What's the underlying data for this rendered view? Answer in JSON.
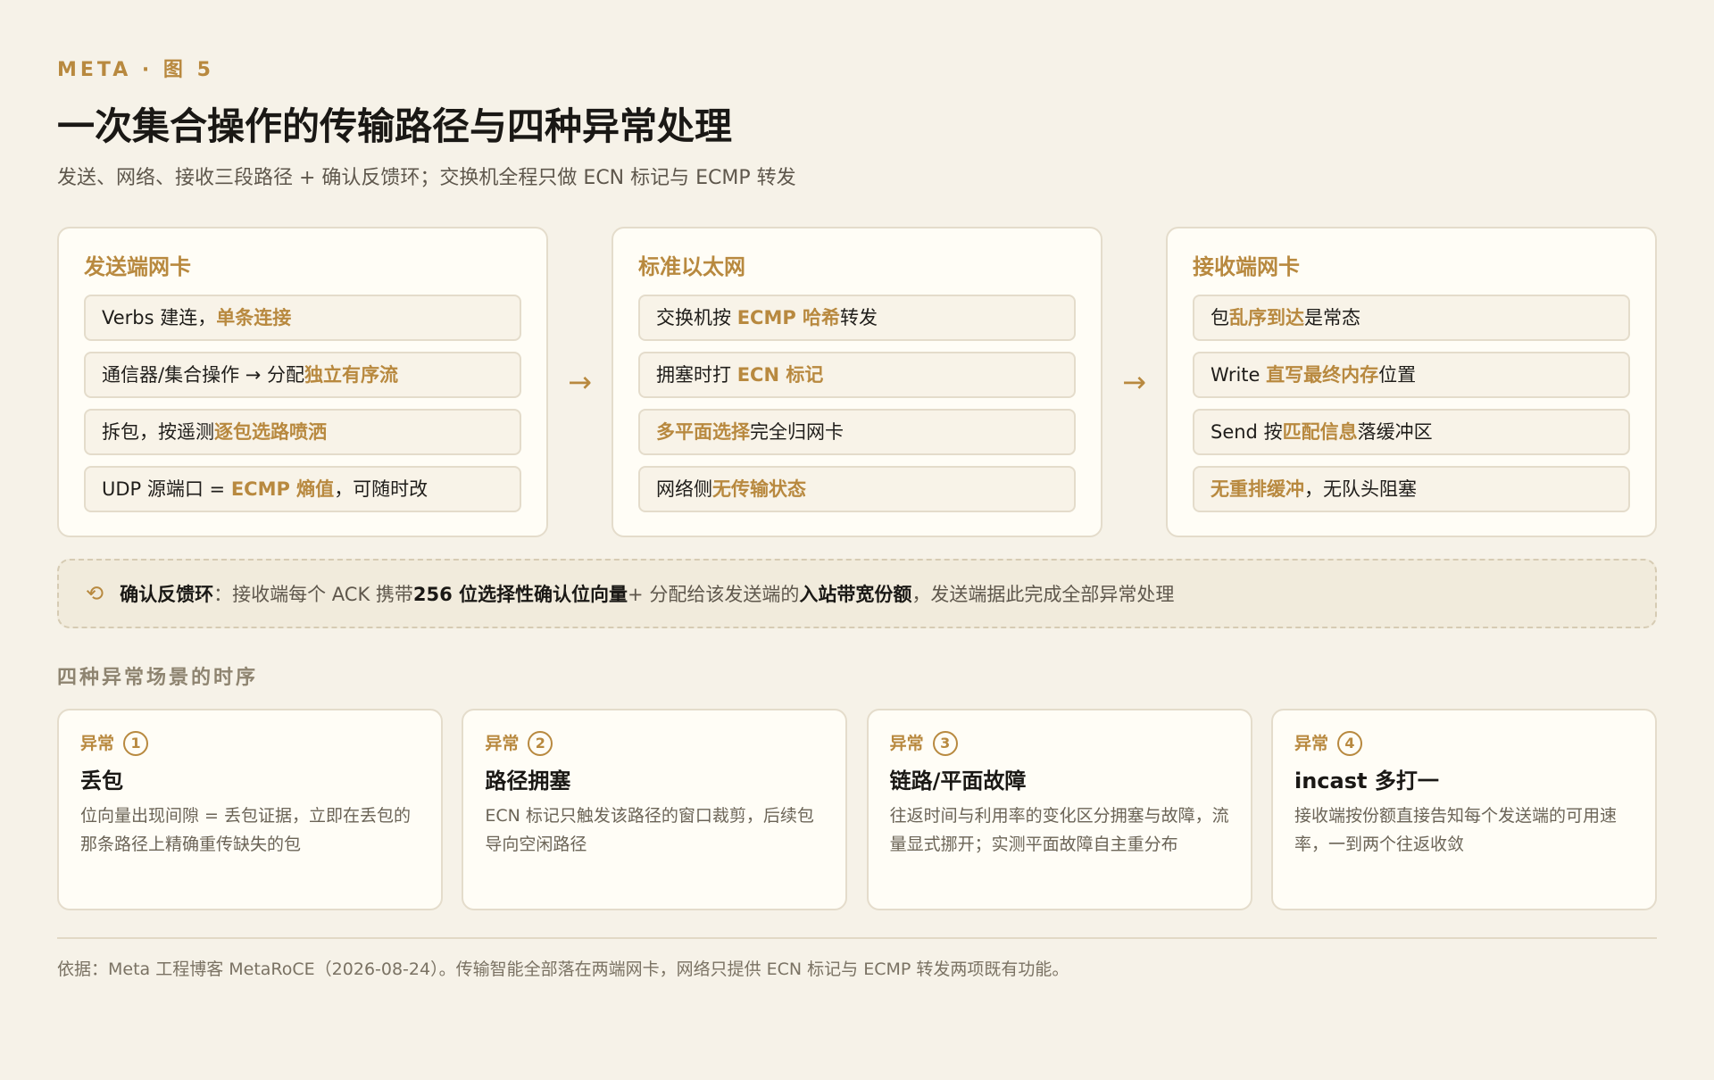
{
  "header": {
    "eyebrow": "META · 图 5",
    "title": "一次集合操作的传输路径与四种异常处理",
    "subtitle": "发送、网络、接收三段路径 + 确认反馈环；交换机全程只做 ECN 标记与 ECMP 转发"
  },
  "stages": [
    {
      "title": "发送端网卡",
      "items": [
        {
          "pre": "Verbs 建连，",
          "hl": "单条连接",
          "post": ""
        },
        {
          "pre": "通信器/集合操作 → 分配",
          "hl": "独立有序流",
          "post": ""
        },
        {
          "pre": "拆包，按遥测",
          "hl": "逐包选路喷洒",
          "post": ""
        },
        {
          "pre": "UDP 源端口 = ",
          "hl": "ECMP 熵值",
          "post": "，可随时改"
        }
      ]
    },
    {
      "title": "标准以太网",
      "items": [
        {
          "pre": "交换机按 ",
          "hl": "ECMP 哈希",
          "post": "转发"
        },
        {
          "pre": "拥塞时打 ",
          "hl": "ECN 标记",
          "post": ""
        },
        {
          "pre": "",
          "hl": "多平面选择",
          "post": "完全归网卡"
        },
        {
          "pre": "网络侧",
          "hl": "无传输状态",
          "post": ""
        }
      ]
    },
    {
      "title": "接收端网卡",
      "items": [
        {
          "pre": "包",
          "hl": "乱序到达",
          "post": "是常态"
        },
        {
          "pre": "Write ",
          "hl": "直写最终内存",
          "post": "位置"
        },
        {
          "pre": "Send 按",
          "hl": "匹配信息",
          "post": "落缓冲区"
        },
        {
          "pre": "",
          "hl": "无重排缓冲",
          "post": "，无队头阻塞"
        }
      ]
    }
  ],
  "flow_arrows": [
    "→",
    "→"
  ],
  "loop": {
    "icon": "⟲",
    "label": "确认反馈环",
    "text1": "：接收端每个 ACK 携带 ",
    "bold1": "256 位选择性确认位向量",
    "text2": " + 分配给该发送端的",
    "bold2": "入站带宽份额",
    "text3": "，发送端据此完成全部异常处理"
  },
  "section_title": "四种异常场景的时序",
  "anomalies": [
    {
      "tag": "异常",
      "num": "1",
      "title": "丢包",
      "desc": "位向量出现间隙 = 丢包证据，立即在丢包的那条路径上精确重传缺失的包"
    },
    {
      "tag": "异常",
      "num": "2",
      "title": "路径拥塞",
      "desc": "ECN 标记只触发该路径的窗口裁剪，后续包导向空闲路径"
    },
    {
      "tag": "异常",
      "num": "3",
      "title": "链路/平面故障",
      "desc": "往返时间与利用率的变化区分拥塞与故障，流量显式挪开；实测平面故障自主重分布"
    },
    {
      "tag": "异常",
      "num": "4",
      "title": "incast 多打一",
      "desc": "接收端按份额直接告知每个发送端的可用速率，一到两个往返收敛"
    }
  ],
  "footer": "依据：Meta 工程博客 MetaRoCE（2026-08-24）。传输智能全部落在两端网卡，网络只提供 ECN 标记与 ECMP 转发两项既有功能。",
  "colors": {
    "accent": "#b8893f",
    "background": "#f6f2e8",
    "card": "#fffdf6",
    "border": "#e4dccb"
  }
}
